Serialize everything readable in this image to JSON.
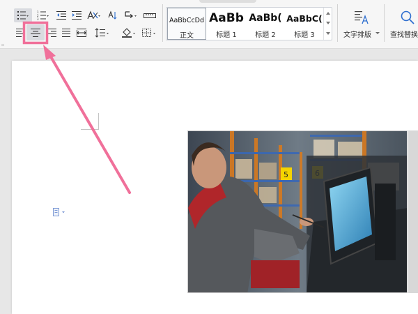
{
  "ribbon": {
    "styles": [
      {
        "sample": "AaBbCcDd",
        "name": "正文",
        "selected": true
      },
      {
        "sample": "AaBb",
        "name": "标题 1",
        "selected": false
      },
      {
        "sample": "AaBb(",
        "name": "标题 2",
        "selected": false
      },
      {
        "sample": "AaBbC(",
        "name": "标题 3",
        "selected": false
      }
    ],
    "text_layout_label": "文字排版",
    "find_replace_label": "查找替换"
  },
  "icons": {
    "bullet_list": "bullet-list-icon",
    "numbered_list": "numbered-list-icon",
    "decrease_indent": "decrease-indent-icon",
    "increase_indent": "increase-indent-icon",
    "chinese_layout": "chinese-layout-icon",
    "sort": "sort-icon",
    "show_hide_marks": "show-hide-marks-icon",
    "tab_ruler": "tab-ruler-icon",
    "align_left": "align-left-icon",
    "align_center": "align-center-icon",
    "align_right": "align-right-icon",
    "justify": "justify-icon",
    "distributed": "distributed-align-icon",
    "line_spacing": "line-spacing-icon",
    "shading": "shading-icon",
    "borders": "borders-icon",
    "text_layout": "text-layout-icon",
    "find_replace": "search-icon",
    "paste_options": "paste-options-icon"
  },
  "colors": {
    "highlight": "#f0709a",
    "ribbon_bg": "#f6f6f6",
    "page_bg": "#ffffff",
    "canvas_bg": "#e7e7e7"
  }
}
